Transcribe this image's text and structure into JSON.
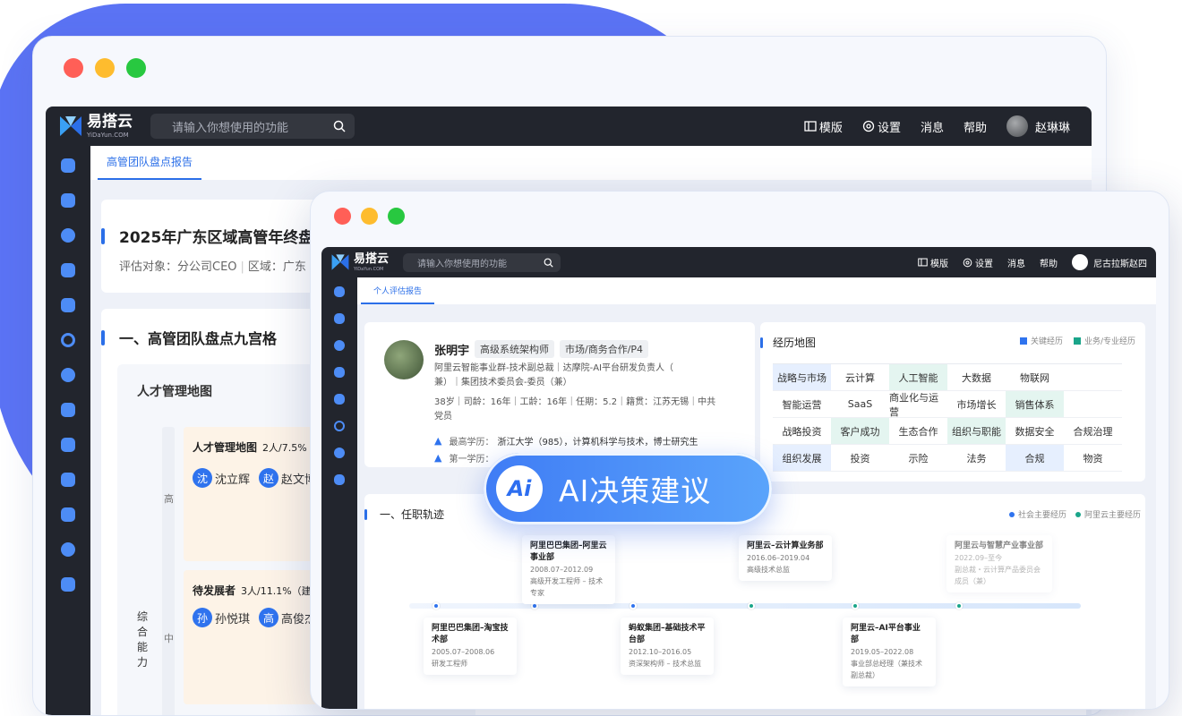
{
  "back_window": {
    "app": {
      "logo_main": "易搭云",
      "logo_sub": "YiDaYun.COM",
      "search_placeholder": "请输入你想使用的功能",
      "nav": {
        "template": "模版",
        "settings": "设置",
        "messages": "消息",
        "help": "帮助",
        "user": "赵琳琳"
      },
      "tab": "高管团队盘点报告",
      "report_title": "2025年广东区域高管年终盘点",
      "report_meta_label1": "评估对象：分公司CEO",
      "report_meta_label2": "区域：广东",
      "section1": "一、高管团队盘点九宫格",
      "grid_title": "人才管理地图",
      "axis_label": "综合能力",
      "row_high": "高",
      "row_mid": "中",
      "cell1": {
        "title": "人才管理地图",
        "count": "2人/7.5%",
        "people": [
          {
            "initial": "沈",
            "name": "沈立辉"
          },
          {
            "initial": "赵",
            "name": "赵文博"
          }
        ]
      },
      "cell2": {
        "title": "待发展者",
        "count": "3人/11.1%（建",
        "people": [
          {
            "initial": "孙",
            "name": "孙悦琪"
          },
          {
            "initial": "高",
            "name": "高俊杰"
          }
        ]
      }
    }
  },
  "front_window": {
    "app": {
      "logo_main": "易搭云",
      "logo_sub": "YiDaYun.COM",
      "search_placeholder": "请输入你想使用的功能",
      "nav": {
        "template": "模版",
        "settings": "设置",
        "messages": "消息",
        "help": "帮助",
        "user": "尼古拉斯赵四"
      },
      "tab": "个人评估报告",
      "profile": {
        "name": "张明宇",
        "tag1": "高级系统架构师",
        "tag2": "市场/商务合作/P4",
        "line1": "阿里云智能事业群-技术副总裁｜达摩院-AI平台研发负责人（",
        "line2": "兼）｜集团技术委员会-委员（兼）",
        "stats1": "38岁｜司龄：16年｜工龄：16年｜任期：5.2｜籍贯：江苏无锡｜中共",
        "stats2": "党员",
        "edu_label": "最高学历：",
        "edu_value": "浙江大学（985），计算机科学与技术，博士研究生",
        "first_edu_label": "第一学历："
      },
      "exp_map": {
        "title": "经历地图",
        "legend_key": "关键经历",
        "legend_pro": "业务/专业经历",
        "colors": {
          "key": "#2f73ee",
          "pro": "#1aa58a"
        },
        "rows": [
          [
            {
              "t": "战略与市场",
              "k": "k"
            },
            {
              "t": "云计算",
              "k": ""
            },
            {
              "t": "人工智能",
              "k": "p"
            },
            {
              "t": "大数据",
              "k": ""
            },
            {
              "t": "物联网",
              "k": ""
            }
          ],
          [
            {
              "t": "智能运营",
              "k": ""
            },
            {
              "t": "SaaS",
              "k": ""
            },
            {
              "t": "商业化与运营",
              "k": ""
            },
            {
              "t": "市场增长",
              "k": ""
            },
            {
              "t": "销售体系",
              "k": "p"
            }
          ],
          [
            {
              "t": "战略投资",
              "k": ""
            },
            {
              "t": "客户成功",
              "k": "p"
            },
            {
              "t": "生态合作",
              "k": ""
            },
            {
              "t": "组织与职能",
              "k": "p"
            },
            {
              "t": "数据安全",
              "k": ""
            },
            {
              "t": "合规治理",
              "k": ""
            }
          ],
          [
            {
              "t": "组织发展",
              "k": "k"
            },
            {
              "t": "投资",
              "k": ""
            },
            {
              "t": "示险",
              "k": ""
            },
            {
              "t": "法务",
              "k": ""
            },
            {
              "t": "合规",
              "k": "k"
            },
            {
              "t": "物资",
              "k": ""
            }
          ]
        ]
      },
      "career": {
        "title": "一、任职轨迹",
        "legend_social": "社会主要经历",
        "legend_ali": "阿里云主要经历",
        "colors": {
          "social": "#2f73ee",
          "ali": "#1aa58a"
        },
        "events": [
          {
            "title": "阿里巴巴集团–淘宝技术部",
            "period": "2005.07–2008.06",
            "role": "研发工程师",
            "pos": "below",
            "type": "social"
          },
          {
            "title": "阿里巴巴集团–阿里云事业部",
            "period": "2008.07–2012.09",
            "role": "高级开发工程师 – 技术专家",
            "pos": "above",
            "type": "social"
          },
          {
            "title": "蚂蚁集团–基础技术平台部",
            "period": "2012.10–2016.05",
            "role": "资深架构师 – 技术总监",
            "pos": "below",
            "type": "social"
          },
          {
            "title": "阿里云–云计算业务部",
            "period": "2016.06–2019.04",
            "role": "高级技术总监",
            "pos": "above",
            "type": "ali"
          },
          {
            "title": "阿里云–AI平台事业部",
            "period": "2019.05–2022.08",
            "role": "事业部总经理（兼技术副总裁）",
            "pos": "below",
            "type": "ali"
          },
          {
            "title": "阿里云与智慧产业事业部",
            "period": "2022.09–至今",
            "role": "副总裁・云计算产品委员会成员（兼）",
            "pos": "above",
            "type": "ali"
          }
        ]
      }
    }
  },
  "ai_button": {
    "logo": "Ai",
    "label": "AI决策建议"
  }
}
